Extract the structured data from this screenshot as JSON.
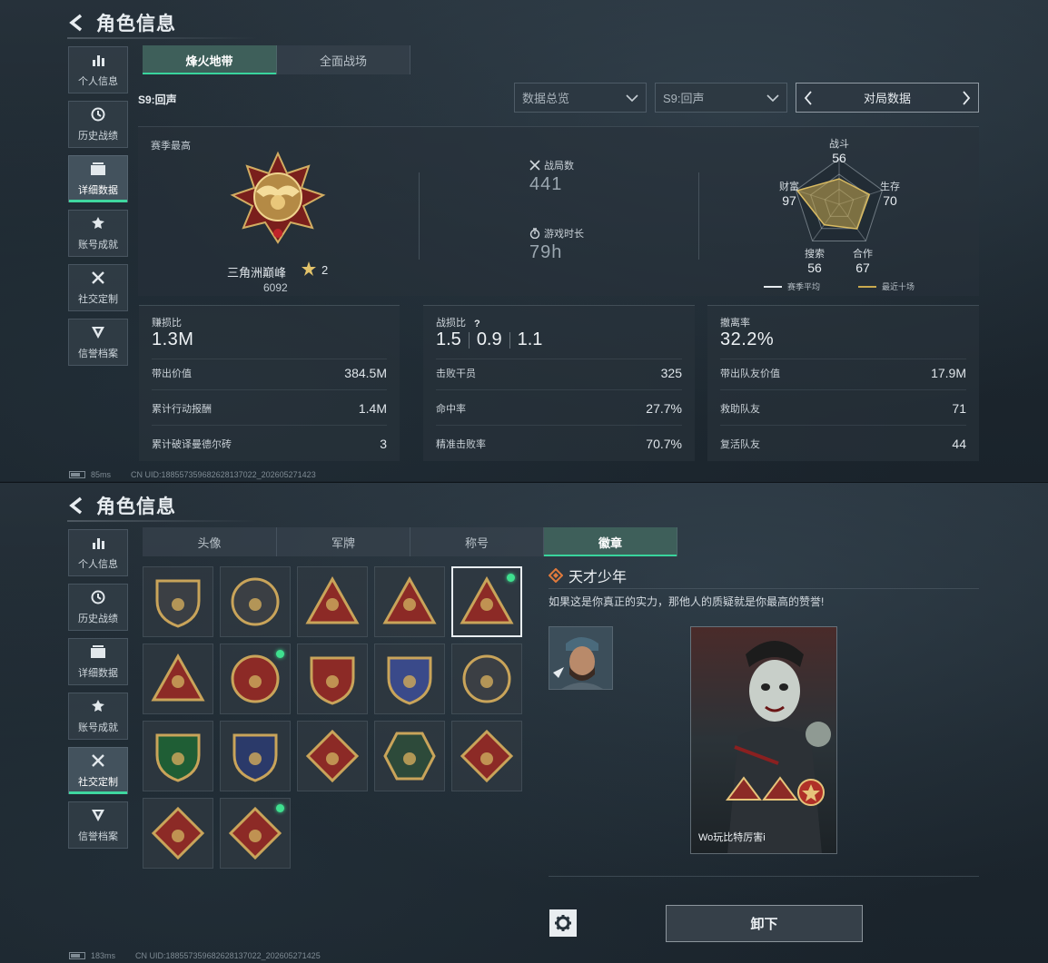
{
  "screen1": {
    "header": {
      "title": "角色信息"
    },
    "nav": [
      {
        "label": "个人信息",
        "icon": "bar-chart-icon"
      },
      {
        "label": "历史战绩",
        "icon": "clock-icon"
      },
      {
        "label": "详细数据",
        "icon": "folder-icon",
        "active": true
      },
      {
        "label": "账号成就",
        "icon": "achievement-icon"
      },
      {
        "label": "社交定制",
        "icon": "tools-icon"
      },
      {
        "label": "信誉档案",
        "icon": "reputation-icon"
      }
    ],
    "tabs": [
      {
        "label": "烽火地带",
        "active": true
      },
      {
        "label": "全面战场",
        "active": false
      }
    ],
    "season_label": "S9:回声",
    "dropdowns": {
      "overview": "数据总览",
      "season": "S9:回声"
    },
    "match_nav_label": "对局数据",
    "season_high": "赛季最高",
    "rank": {
      "name": "三角洲巅峰",
      "stars": "2",
      "score": "6092"
    },
    "matches": {
      "label": "战局数",
      "value": "441"
    },
    "playtime": {
      "label": "游戏时长",
      "value": "79h"
    },
    "radar": {
      "combat": {
        "label": "战斗",
        "value": "56"
      },
      "survival": {
        "label": "生存",
        "value": "70"
      },
      "coop": {
        "label": "合作",
        "value": "67"
      },
      "search": {
        "label": "搜索",
        "value": "56"
      },
      "wealth": {
        "label": "财富",
        "value": "97"
      },
      "legend_season": "赛季平均",
      "legend_recent": "最近十场"
    },
    "cards": {
      "profit": {
        "label": "赚损比",
        "value": "1.3M",
        "rows": [
          {
            "k": "带出价值",
            "v": "384.5M"
          },
          {
            "k": "累计行动报酬",
            "v": "1.4M"
          },
          {
            "k": "累计破译曼德尔砖",
            "v": "3"
          }
        ]
      },
      "kd": {
        "label": "战损比",
        "values": [
          "1.5",
          "0.9",
          "1.1"
        ],
        "rows": [
          {
            "k": "击败干员",
            "v": "325"
          },
          {
            "k": "命中率",
            "v": "27.7%"
          },
          {
            "k": "精准击败率",
            "v": "70.7%"
          }
        ]
      },
      "extract": {
        "label": "撤离率",
        "value": "32.2%",
        "rows": [
          {
            "k": "带出队友价值",
            "v": "17.9M"
          },
          {
            "k": "救助队友",
            "v": "71"
          },
          {
            "k": "复活队友",
            "v": "44"
          }
        ]
      }
    },
    "footer": {
      "ping": "85ms",
      "uid": "CN UID:1885573596826281370​22_202605271423"
    }
  },
  "screen2": {
    "header": {
      "title": "角色信息"
    },
    "nav": [
      {
        "label": "个人信息",
        "icon": "bar-chart-icon"
      },
      {
        "label": "历史战绩",
        "icon": "clock-icon"
      },
      {
        "label": "详细数据",
        "icon": "folder-icon"
      },
      {
        "label": "账号成就",
        "icon": "achievement-icon"
      },
      {
        "label": "社交定制",
        "icon": "tools-icon",
        "active": true
      },
      {
        "label": "信誉档案",
        "icon": "reputation-icon"
      }
    ],
    "tabs": [
      {
        "label": "头像",
        "active": false
      },
      {
        "label": "军牌",
        "active": false
      },
      {
        "label": "称号",
        "active": false
      },
      {
        "label": "徽章",
        "active": true
      }
    ],
    "badges": [
      {
        "icon": "shield-triangle-badge-icon",
        "new": false
      },
      {
        "icon": "helicopter-badge-icon",
        "new": false
      },
      {
        "icon": "tower-triangle-badge-icon",
        "new": false
      },
      {
        "icon": "number-one-badge-icon",
        "new": false
      },
      {
        "icon": "genius-triangle-badge-icon",
        "new": true,
        "selected": true
      },
      {
        "icon": "soldiers-triangle-badge-icon",
        "new": false
      },
      {
        "icon": "star-wreath-badge-icon",
        "new": true
      },
      {
        "icon": "stars-shield-badge-icon",
        "new": false
      },
      {
        "icon": "crystal-shield-badge-icon",
        "new": false
      },
      {
        "icon": "skull-round-badge-icon",
        "new": false
      },
      {
        "icon": "crosshair-green-badge-icon",
        "new": false
      },
      {
        "icon": "crossed-rifles-badge-icon",
        "new": false
      },
      {
        "icon": "wolf-diamond-badge-icon",
        "new": false
      },
      {
        "icon": "wasp-hexagon-badge-icon",
        "new": false
      },
      {
        "icon": "dragon-diamond-badge-icon",
        "new": false
      },
      {
        "icon": "dragon-diamond-2-badge-icon",
        "new": false
      },
      {
        "icon": "runner-diamond-badge-icon",
        "new": true
      }
    ],
    "detail": {
      "name": "天才少年",
      "desc": "如果这是你真正的实力，那他人的质疑就是你最高的赞誉!",
      "card_name": "Wo玩比特厉害i"
    },
    "unequip_label": "卸下",
    "footer": {
      "ping": "183ms",
      "uid": "CN UID:1885573596826281370​22_202605271425"
    }
  },
  "colors": {
    "accent": "#39d49d",
    "new_dot": "#3fe08f",
    "gold": "#c9a45a",
    "red": "#8c2a26"
  }
}
